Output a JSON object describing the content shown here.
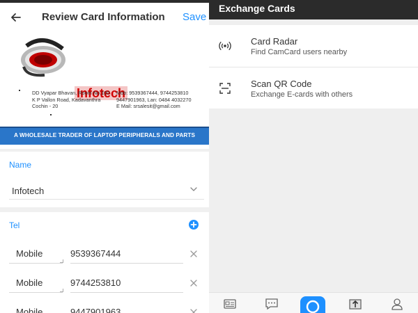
{
  "left": {
    "header": {
      "title": "Review Card Information",
      "save_label": "Save",
      "back_icon": "arrow-left-icon"
    },
    "card": {
      "logo_icon": "company-logo",
      "brand": "Infotech",
      "address": [
        "DD Vyapar Bhavan, Room No.100",
        "K P Vallon Road, Kadavanthra",
        "Cochin - 20"
      ],
      "contact": [
        "Mob: 9539367444, 9744253810",
        "9447901963, Lan: 0484 4032270",
        "E Mail: srsalesit@gmail.com"
      ],
      "banner": "A WHOLESALE TRADER OF LAPTOP PERIPHERALS AND PARTS",
      "banner_color": "#2a76c9"
    },
    "name": {
      "label": "Name",
      "value": "Infotech",
      "chevron_icon": "chevron-down-icon"
    },
    "tel": {
      "label": "Tel",
      "add_icon": "plus-circle-icon",
      "rows": [
        {
          "type": "Mobile",
          "number": "9539367444"
        },
        {
          "type": "Mobile",
          "number": "9744253810"
        },
        {
          "type": "Mobile",
          "number": "9447901963"
        }
      ]
    }
  },
  "right": {
    "header": {
      "title": "Exchange Cards"
    },
    "menu": [
      {
        "title": "Card Radar",
        "subtitle": "Find CamCard users nearby",
        "icon": "radar-icon"
      },
      {
        "title": "Scan QR Code",
        "subtitle": "Exchange E-cards with others",
        "icon": "scan-icon"
      }
    ],
    "bottom_nav": [
      "cards-icon",
      "chat-icon",
      "camera-icon",
      "upload-icon",
      "profile-icon"
    ]
  },
  "colors": {
    "accent": "#1e90ff",
    "dark_header": "#2b2b2b",
    "brand_red": "#d10000"
  }
}
